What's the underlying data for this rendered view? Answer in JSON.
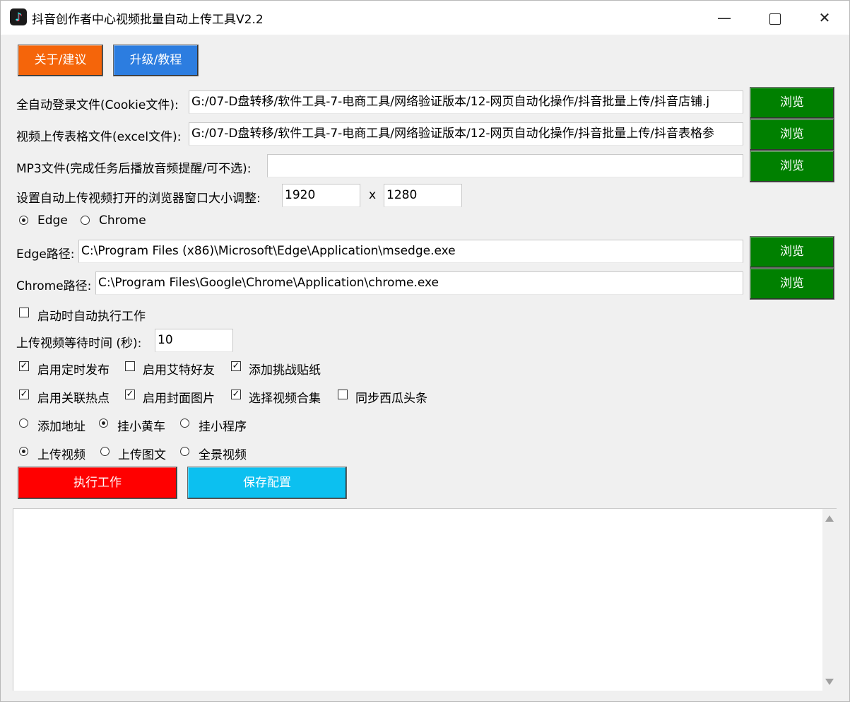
{
  "window": {
    "title": "抖音创作者中心视频批量自动上传工具V2.2",
    "icon": "tiktok-logo-icon",
    "minimize": "—",
    "close": "✕"
  },
  "toolbar": {
    "about_label": "关于/建议",
    "upgrade_label": "升级/教程",
    "about_color": "#f5650a",
    "upgrade_color": "#2c7de0"
  },
  "files": {
    "cookie_label": "全自动登录文件(Cookie文件):",
    "cookie_value": "G:/07-D盘转移/软件工具-7-电商工具/网络验证版本/12-网页自动化操作/抖音批量上传/抖音店铺.j",
    "excel_label": "视频上传表格文件(excel文件):",
    "excel_value": "G:/07-D盘转移/软件工具-7-电商工具/网络验证版本/12-网页自动化操作/抖音批量上传/抖音表格参",
    "mp3_label": "MP3文件(完成任务后播放音频提醒/可不选):",
    "mp3_value": "",
    "browse_label": "浏览",
    "browse_color": "#008000"
  },
  "window_size": {
    "label": "设置自动上传视频打开的浏览器窗口大小调整:",
    "width": "1920",
    "separator": "x",
    "height": "1280"
  },
  "browser": {
    "options": [
      {
        "label": "Edge",
        "selected": true
      },
      {
        "label": "Chrome",
        "selected": false
      }
    ],
    "edge_path_label": "Edge路径:",
    "edge_path_value": "C:\\Program Files (x86)\\Microsoft\\Edge\\Application\\msedge.exe",
    "chrome_path_label": "Chrome路径:",
    "chrome_path_value": "C:\\Program Files\\Google\\Chrome\\Application\\chrome.exe"
  },
  "autostart": {
    "label": "启动时自动执行工作",
    "checked": false
  },
  "wait_time": {
    "label": "上传视频等待时间 (秒):",
    "value": "10"
  },
  "options_row1": [
    {
      "label": "启用定时发布",
      "checked": true
    },
    {
      "label": "启用艾特好友",
      "checked": false
    },
    {
      "label": "添加挑战贴纸",
      "checked": true
    }
  ],
  "options_row2": [
    {
      "label": "启用关联热点",
      "checked": true
    },
    {
      "label": "启用封面图片",
      "checked": true
    },
    {
      "label": "选择视频合集",
      "checked": true
    },
    {
      "label": "同步西瓜头条",
      "checked": false
    }
  ],
  "attach_options": [
    {
      "label": "添加地址",
      "selected": false
    },
    {
      "label": "挂小黄车",
      "selected": true
    },
    {
      "label": "挂小程序",
      "selected": false
    }
  ],
  "upload_type": [
    {
      "label": "上传视频",
      "selected": true
    },
    {
      "label": "上传图文",
      "selected": false
    },
    {
      "label": "全景视频",
      "selected": false
    }
  ],
  "actions": {
    "run_label": "执行工作",
    "save_label": "保存配置",
    "run_color": "#ff0000",
    "save_color": "#0cc0f0"
  },
  "log": {
    "content": ""
  }
}
